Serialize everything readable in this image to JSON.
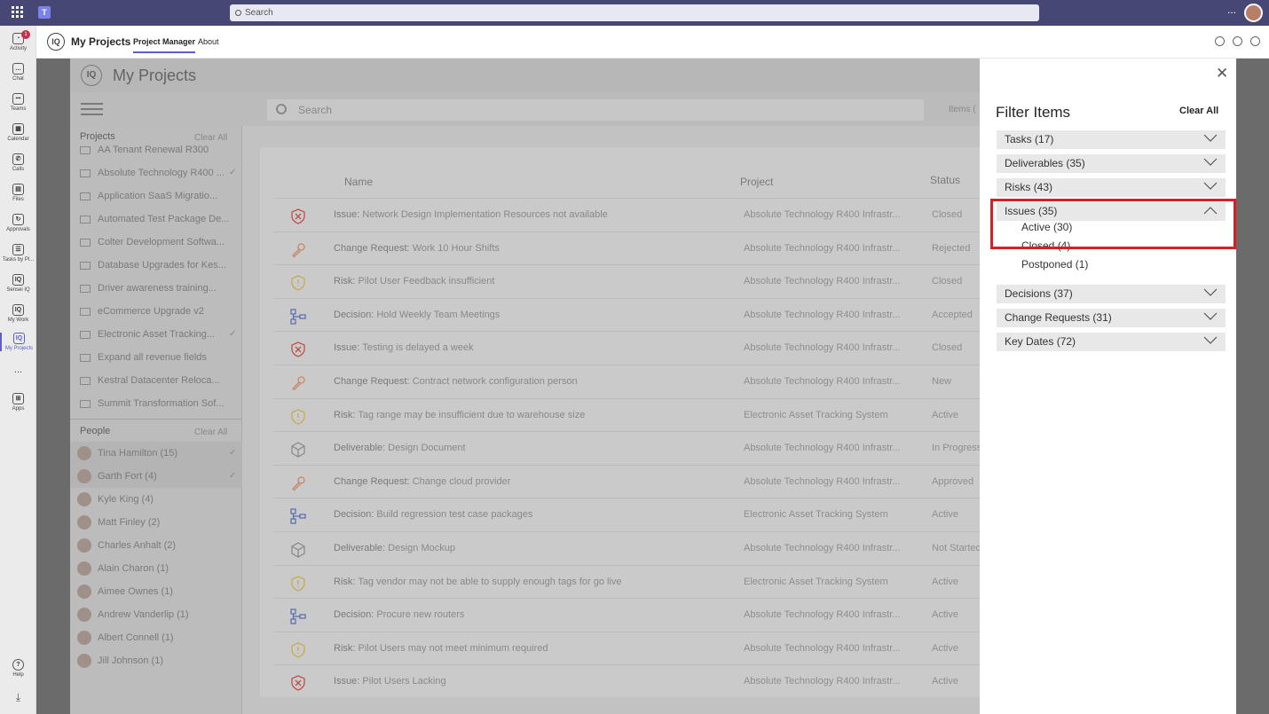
{
  "topbar": {
    "search_placeholder": "Search",
    "more": "..."
  },
  "rail": [
    {
      "label": "Activity",
      "icon": "bell-icon",
      "badge": "1"
    },
    {
      "label": "Chat",
      "icon": "chat-icon"
    },
    {
      "label": "Teams",
      "icon": "teams-icon"
    },
    {
      "label": "Calendar",
      "icon": "calendar-icon"
    },
    {
      "label": "Calls",
      "icon": "phone-icon"
    },
    {
      "label": "Files",
      "icon": "file-icon"
    },
    {
      "label": "Approvals",
      "icon": "approvals-icon"
    },
    {
      "label": "Tasks by Pl...",
      "icon": "tasks-icon"
    },
    {
      "label": "Sensei IQ",
      "icon": "iq-icon"
    },
    {
      "label": "My Work",
      "icon": "iq-icon"
    },
    {
      "label": "My Projects",
      "icon": "iq-icon"
    },
    {
      "label": "...",
      "icon": "more-icon"
    },
    {
      "label": "Apps",
      "icon": "apps-icon"
    },
    {
      "label": "Help",
      "icon": "help-icon"
    }
  ],
  "app": {
    "logo": "IQ",
    "title": "My Projects",
    "tabs": [
      "Project Manager",
      "About"
    ]
  },
  "iq": {
    "logo": "IQ",
    "title": "My Projects",
    "search_placeholder": "Search",
    "items_label": "Items (",
    "projects_header": "Projects",
    "people_header": "People",
    "clear_all": "Clear All",
    "projects": [
      {
        "name": "AA Tenant Renewal R300",
        "checked": false
      },
      {
        "name": "Absolute Technology R400 ...",
        "checked": true
      },
      {
        "name": "Application SaaS Migratio...",
        "checked": false
      },
      {
        "name": "Automated Test Package De...",
        "checked": false
      },
      {
        "name": "Colter Development Softwa...",
        "checked": false
      },
      {
        "name": "Database Upgrades for Kes...",
        "checked": false
      },
      {
        "name": "Driver awareness training...",
        "checked": false
      },
      {
        "name": "eCommerce Upgrade v2",
        "checked": false
      },
      {
        "name": "Electronic Asset Tracking...",
        "checked": true
      },
      {
        "name": "Expand all revenue fields",
        "checked": false
      },
      {
        "name": "Kestral Datacenter Reloca...",
        "checked": false
      },
      {
        "name": "Summit Transformation Sof...",
        "checked": false
      }
    ],
    "people": [
      {
        "name": "Tina Hamilton (15)",
        "checked": true
      },
      {
        "name": "Garth Fort (4)",
        "checked": true
      },
      {
        "name": "Kyle King (4)",
        "checked": false
      },
      {
        "name": "Matt Finley (2)",
        "checked": false
      },
      {
        "name": "Charles Anhalt (2)",
        "checked": false
      },
      {
        "name": "Alain Charon (1)",
        "checked": false
      },
      {
        "name": "Aimee Ownes (1)",
        "checked": false
      },
      {
        "name": "Andrew Vanderlip (1)",
        "checked": false
      },
      {
        "name": "Albert Connell (1)",
        "checked": false
      },
      {
        "name": "Jill Johnson (1)",
        "checked": false
      }
    ],
    "columns": [
      "Name",
      "Project",
      "Status"
    ],
    "rows": [
      {
        "type": "Issue:",
        "title": "Network Design Implementation Resources not available",
        "project": "Absolute Technology R400 Infrastr...",
        "status": "Closed",
        "icon": "issue"
      },
      {
        "type": "Change Request:",
        "title": "Work 10 Hour Shifts",
        "project": "Absolute Technology R400 Infrastr...",
        "status": "Rejected",
        "icon": "change"
      },
      {
        "type": "Risk:",
        "title": "Pilot User Feedback insufficient",
        "project": "Absolute Technology R400 Infrastr...",
        "status": "Closed",
        "icon": "risk"
      },
      {
        "type": "Decision:",
        "title": "Hold Weekly Team Meetings",
        "project": "Absolute Technology R400 Infrastr...",
        "status": "Accepted",
        "icon": "decision"
      },
      {
        "type": "Issue:",
        "title": "Testing is delayed a week",
        "project": "Absolute Technology R400 Infrastr...",
        "status": "Closed",
        "icon": "issue"
      },
      {
        "type": "Change Request:",
        "title": "Contract network configuration person",
        "project": "Absolute Technology R400 Infrastr...",
        "status": "New",
        "icon": "change"
      },
      {
        "type": "Risk:",
        "title": "Tag range may be insufficient due to warehouse size",
        "project": "Electronic Asset Tracking System",
        "status": "Active",
        "icon": "risk"
      },
      {
        "type": "Deliverable:",
        "title": "Design Document",
        "project": "Absolute Technology R400 Infrastr...",
        "status": "In Progress",
        "icon": "deliverable"
      },
      {
        "type": "Change Request:",
        "title": "Change cloud provider",
        "project": "Absolute Technology R400 Infrastr...",
        "status": "Approved",
        "icon": "change"
      },
      {
        "type": "Decision:",
        "title": "Build regression test case packages",
        "project": "Electronic Asset Tracking System",
        "status": "Active",
        "icon": "decision"
      },
      {
        "type": "Deliverable:",
        "title": "Design Mockup",
        "project": "Absolute Technology R400 Infrastr...",
        "status": "Not Started",
        "icon": "deliverable"
      },
      {
        "type": "Risk:",
        "title": "Tag vendor may not be able to supply enough tags for go live",
        "project": "Electronic Asset Tracking System",
        "status": "Active",
        "icon": "risk"
      },
      {
        "type": "Decision:",
        "title": "Procure new routers",
        "project": "Absolute Technology R400 Infrastr...",
        "status": "Active",
        "icon": "decision"
      },
      {
        "type": "Risk:",
        "title": "Pilot Users may not meet minimum required",
        "project": "Absolute Technology R400 Infrastr...",
        "status": "Active",
        "icon": "risk"
      },
      {
        "type": "Issue:",
        "title": "Pilot Users Lacking",
        "project": "Absolute Technology R400 Infrastr...",
        "status": "Active",
        "icon": "issue"
      }
    ]
  },
  "filter": {
    "title": "Filter Items",
    "clear_all": "Clear All",
    "groups": [
      {
        "label": "Tasks",
        "count": "(17)",
        "expanded": false
      },
      {
        "label": "Deliverables",
        "count": "(35)",
        "expanded": false
      },
      {
        "label": "Risks",
        "count": "(43)",
        "expanded": false
      },
      {
        "label": "Issues",
        "count": "(35)",
        "expanded": true,
        "options": [
          "Active (30)",
          "Closed (4)",
          "Postponed (1)"
        ]
      },
      {
        "label": "Decisions",
        "count": "(37)",
        "expanded": false
      },
      {
        "label": "Change Requests",
        "count": "(31)",
        "expanded": false
      },
      {
        "label": "Key Dates",
        "count": "(72)",
        "expanded": false
      }
    ]
  },
  "colors": {
    "teams_purple": "#464775",
    "highlight": "#d62027",
    "issue": "#d9534f",
    "change": "#e8956b",
    "risk": "#e3c25a",
    "decision": "#5b73c7",
    "deliverable": "#999999"
  }
}
